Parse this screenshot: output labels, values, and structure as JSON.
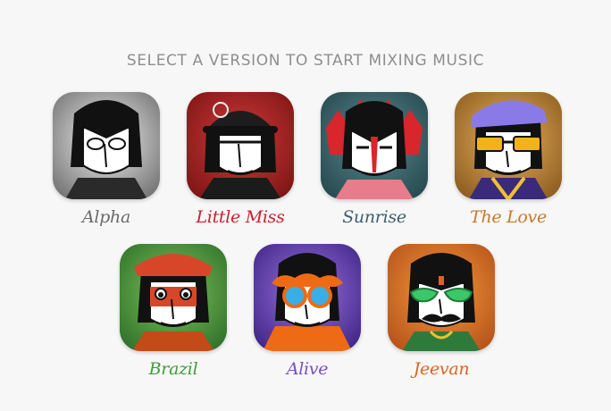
{
  "heading": "SELECT A VERSION TO START MIXING MUSIC",
  "versions": [
    {
      "label": "Alpha",
      "color": "#6b6b6b",
      "icon": "alpha-character-icon"
    },
    {
      "label": "Little Miss",
      "color": "#c8202c",
      "icon": "little-miss-character-icon"
    },
    {
      "label": "Sunrise",
      "color": "#3e5f6b",
      "icon": "sunrise-character-icon"
    },
    {
      "label": "The Love",
      "color": "#c8782a",
      "icon": "the-love-character-icon"
    },
    {
      "label": "Brazil",
      "color": "#3f9a3a",
      "icon": "brazil-character-icon"
    },
    {
      "label": "Alive",
      "color": "#7a4fc0",
      "icon": "alive-character-icon"
    },
    {
      "label": "Jeevan",
      "color": "#e0621e",
      "icon": "jeevan-character-icon"
    }
  ]
}
